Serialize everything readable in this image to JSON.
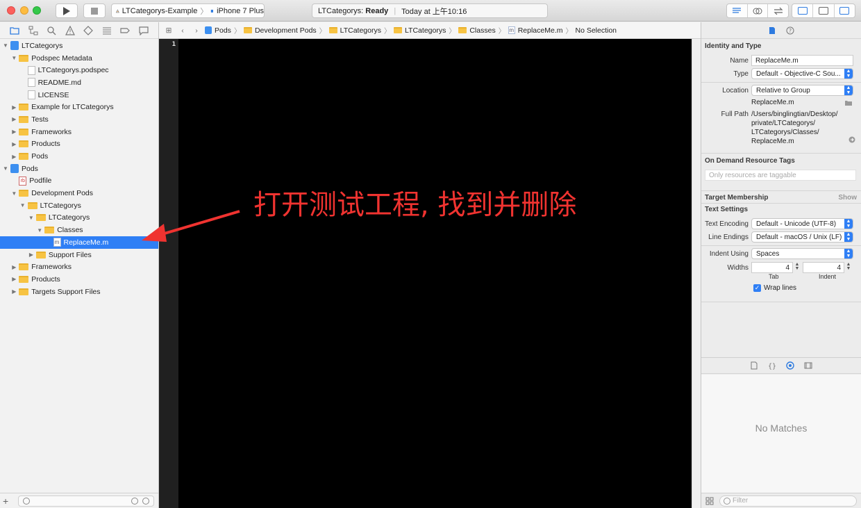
{
  "toolbar": {
    "scheme": "LTCategorys-Example",
    "device": "iPhone 7 Plus",
    "activity_project": "LTCategorys:",
    "activity_status": "Ready",
    "activity_time": "Today at 上午10:16"
  },
  "navigator": {
    "tree": [
      {
        "label": "LTCategorys",
        "kind": "project",
        "depth": 0,
        "disc": "▼"
      },
      {
        "label": "Podspec Metadata",
        "kind": "folder",
        "depth": 1,
        "disc": "▼"
      },
      {
        "label": "LTCategorys.podspec",
        "kind": "file",
        "depth": 2,
        "disc": ""
      },
      {
        "label": "README.md",
        "kind": "file",
        "depth": 2,
        "disc": ""
      },
      {
        "label": "LICENSE",
        "kind": "file",
        "depth": 2,
        "disc": ""
      },
      {
        "label": "Example for LTCategorys",
        "kind": "folder",
        "depth": 1,
        "disc": "▶"
      },
      {
        "label": "Tests",
        "kind": "folder",
        "depth": 1,
        "disc": "▶"
      },
      {
        "label": "Frameworks",
        "kind": "folder",
        "depth": 1,
        "disc": "▶"
      },
      {
        "label": "Products",
        "kind": "folder",
        "depth": 1,
        "disc": "▶"
      },
      {
        "label": "Pods",
        "kind": "folder",
        "depth": 1,
        "disc": "▶"
      },
      {
        "label": "Pods",
        "kind": "project",
        "depth": 0,
        "disc": "▼"
      },
      {
        "label": "Podfile",
        "kind": "rb",
        "depth": 1,
        "disc": ""
      },
      {
        "label": "Development Pods",
        "kind": "folder",
        "depth": 1,
        "disc": "▼"
      },
      {
        "label": "LTCategorys",
        "kind": "folder",
        "depth": 2,
        "disc": "▼"
      },
      {
        "label": "LTCategorys",
        "kind": "folder",
        "depth": 3,
        "disc": "▼"
      },
      {
        "label": "Classes",
        "kind": "folder",
        "depth": 4,
        "disc": "▼"
      },
      {
        "label": "ReplaceMe.m",
        "kind": "m",
        "depth": 5,
        "disc": "",
        "selected": true
      },
      {
        "label": "Support Files",
        "kind": "folder",
        "depth": 3,
        "disc": "▶"
      },
      {
        "label": "Frameworks",
        "kind": "folder",
        "depth": 1,
        "disc": "▶"
      },
      {
        "label": "Products",
        "kind": "folder",
        "depth": 1,
        "disc": "▶"
      },
      {
        "label": "Targets Support Files",
        "kind": "folder",
        "depth": 1,
        "disc": "▶"
      }
    ]
  },
  "jumpbar": {
    "crumbs": [
      "Pods",
      "Development Pods",
      "LTCategorys",
      "LTCategorys",
      "Classes",
      "ReplaceMe.m"
    ],
    "last": "No Selection"
  },
  "editor": {
    "line_number": "1",
    "annotation": "打开测试工程, 找到并删除",
    "annotation_color": "#f03330"
  },
  "inspector": {
    "identity_header": "Identity and Type",
    "name_label": "Name",
    "name_value": "ReplaceMe.m",
    "type_label": "Type",
    "type_value": "Default - Objective-C Sou...",
    "location_label": "Location",
    "location_value": "Relative to Group",
    "location_file": "ReplaceMe.m",
    "fullpath_label": "Full Path",
    "fullpath_lines": [
      "/Users/binglingtian/Desktop/",
      "private/LTCategorys/",
      "LTCategorys/Classes/",
      "ReplaceMe.m"
    ],
    "ondemand_header": "On Demand Resource Tags",
    "tags_placeholder": "Only resources are taggable",
    "target_header": "Target Membership",
    "target_show": "Show",
    "text_settings_header": "Text Settings",
    "encoding_label": "Text Encoding",
    "encoding_value": "Default - Unicode (UTF-8)",
    "endings_label": "Line Endings",
    "endings_value": "Default - macOS / Unix (LF)",
    "indent_label": "Indent Using",
    "indent_value": "Spaces",
    "widths_label": "Widths",
    "tab_value": "4",
    "indent_width_value": "4",
    "tab_caption": "Tab",
    "indent_caption": "Indent",
    "wrap_label": "Wrap lines",
    "no_matches": "No Matches",
    "filter_placeholder": "Filter"
  },
  "colors": {
    "accent": "#2f7ff5",
    "folder": "#f7c343",
    "editor_bg": "#000000"
  }
}
